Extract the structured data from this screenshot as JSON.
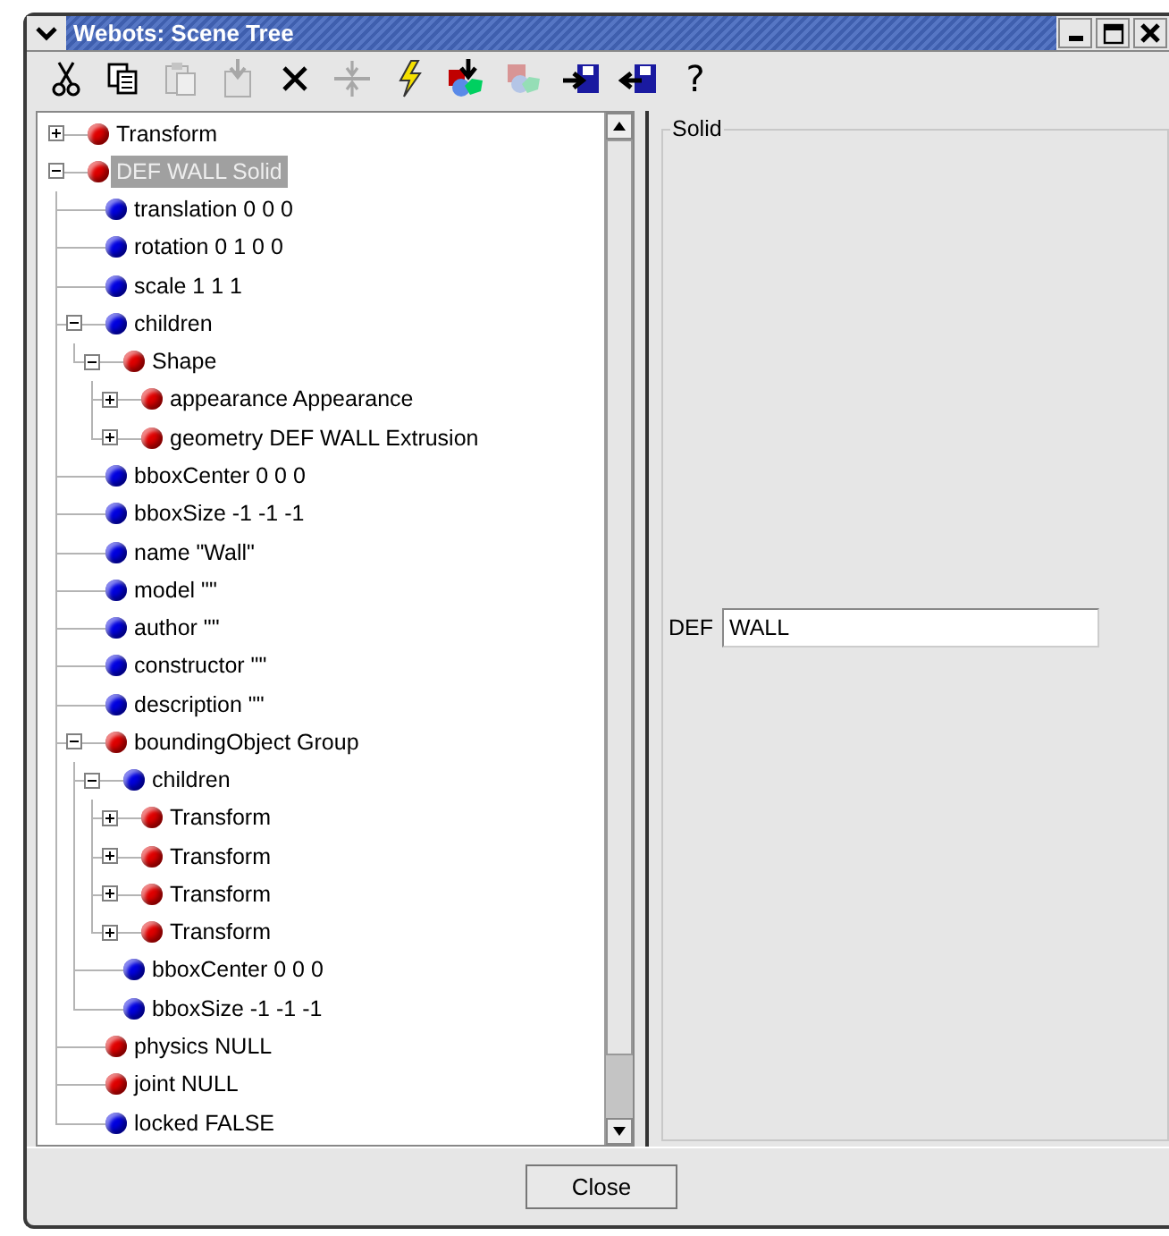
{
  "window": {
    "title": "Webots: Scene Tree"
  },
  "toolbar": [
    {
      "kind": "cut",
      "disabled": false
    },
    {
      "kind": "copy",
      "disabled": false
    },
    {
      "kind": "paste",
      "disabled": true
    },
    {
      "kind": "paste-into",
      "disabled": true
    },
    {
      "kind": "delete",
      "disabled": false
    },
    {
      "kind": "split",
      "disabled": true
    },
    {
      "kind": "lightning",
      "disabled": false
    },
    {
      "kind": "insert-shapes",
      "disabled": false
    },
    {
      "kind": "shapes",
      "disabled": true
    },
    {
      "kind": "import",
      "disabled": false
    },
    {
      "kind": "export",
      "disabled": false
    },
    {
      "kind": "help",
      "text": "?",
      "disabled": false
    }
  ],
  "tree": [
    {
      "label": "Transform",
      "color": "#e00000",
      "expanded": false,
      "selected": false
    },
    {
      "label": "DEF WALL Solid",
      "color": "#e00000",
      "expanded": true,
      "selected": true,
      "children": [
        {
          "label": "translation 0 0 0",
          "color": "#0000e0",
          "selected": false
        },
        {
          "label": "rotation 0 1 0 0",
          "color": "#0000e0",
          "selected": false
        },
        {
          "label": "scale 1 1 1",
          "color": "#0000e0",
          "selected": false
        },
        {
          "label": "children",
          "color": "#0000e0",
          "expanded": true,
          "selected": false,
          "children": [
            {
              "label": "Shape",
              "color": "#e00000",
              "expanded": true,
              "selected": false,
              "children": [
                {
                  "label": "appearance Appearance",
                  "color": "#e00000",
                  "expanded": false,
                  "selected": false
                },
                {
                  "label": "geometry DEF WALL Extrusion",
                  "color": "#e00000",
                  "expanded": false,
                  "selected": false
                }
              ]
            }
          ]
        },
        {
          "label": "bboxCenter 0 0 0",
          "color": "#0000e0",
          "selected": false
        },
        {
          "label": "bboxSize -1 -1 -1",
          "color": "#0000e0",
          "selected": false
        },
        {
          "label": "name \"Wall\"",
          "color": "#0000e0",
          "selected": false
        },
        {
          "label": "model \"\"",
          "color": "#0000e0",
          "selected": false
        },
        {
          "label": "author \"\"",
          "color": "#0000e0",
          "selected": false
        },
        {
          "label": "constructor \"\"",
          "color": "#0000e0",
          "selected": false
        },
        {
          "label": "description \"\"",
          "color": "#0000e0",
          "selected": false
        },
        {
          "label": "boundingObject Group",
          "color": "#e00000",
          "expanded": true,
          "selected": false,
          "children": [
            {
              "label": "children",
              "color": "#0000e0",
              "expanded": true,
              "selected": false,
              "children": [
                {
                  "label": "Transform",
                  "color": "#e00000",
                  "expanded": false,
                  "selected": false
                },
                {
                  "label": "Transform",
                  "color": "#e00000",
                  "expanded": false,
                  "selected": false
                },
                {
                  "label": "Transform",
                  "color": "#e00000",
                  "expanded": false,
                  "selected": false
                },
                {
                  "label": "Transform",
                  "color": "#e00000",
                  "expanded": false,
                  "selected": false
                }
              ]
            },
            {
              "label": "bboxCenter 0 0 0",
              "color": "#0000e0",
              "selected": false
            },
            {
              "label": "bboxSize -1 -1 -1",
              "color": "#0000e0",
              "selected": false
            }
          ]
        },
        {
          "label": "physics NULL",
          "color": "#e00000",
          "selected": false
        },
        {
          "label": "joint NULL",
          "color": "#e00000",
          "selected": false
        },
        {
          "label": "locked FALSE",
          "color": "#0000e0",
          "selected": false
        }
      ]
    }
  ],
  "inspector": {
    "group": "Solid",
    "def_label": "DEF",
    "def_value": "WALL"
  },
  "buttons": [
    "Close"
  ]
}
